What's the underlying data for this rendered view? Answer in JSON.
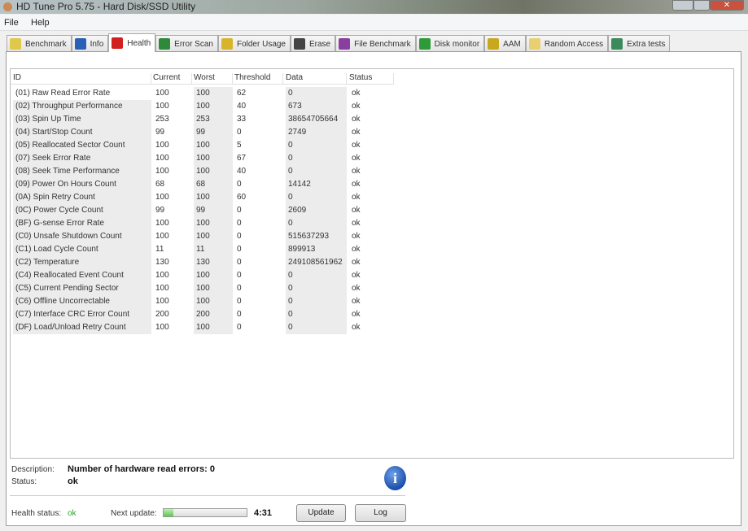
{
  "window": {
    "title": "HD Tune Pro 5.75 - Hard Disk/SSD Utility"
  },
  "menu": [
    "File",
    "Help"
  ],
  "tabs": [
    {
      "label": "Benchmark",
      "color": "#e0c84a"
    },
    {
      "label": "Info",
      "color": "#2a5fb8"
    },
    {
      "label": "Health",
      "color": "#d22020"
    },
    {
      "label": "Error Scan",
      "color": "#2e8a3a"
    },
    {
      "label": "Folder Usage",
      "color": "#d7b52a"
    },
    {
      "label": "Erase",
      "color": "#444444"
    },
    {
      "label": "File Benchmark",
      "color": "#8a3fa0"
    },
    {
      "label": "Disk monitor",
      "color": "#2f9a3a"
    },
    {
      "label": "AAM",
      "color": "#c9a820"
    },
    {
      "label": "Random Access",
      "color": "#e8d070"
    },
    {
      "label": "Extra tests",
      "color": "#3a8a5a"
    }
  ],
  "active_tab": "Health",
  "table": {
    "columns": [
      "ID",
      "Current",
      "Worst",
      "Threshold",
      "Data",
      "Status"
    ],
    "rows": [
      [
        "(01) Raw Read Error Rate",
        "100",
        "100",
        "62",
        "0",
        "ok"
      ],
      [
        "(02) Throughput Performance",
        "100",
        "100",
        "40",
        "673",
        "ok"
      ],
      [
        "(03) Spin Up Time",
        "253",
        "253",
        "33",
        "38654705664",
        "ok"
      ],
      [
        "(04) Start/Stop Count",
        "99",
        "99",
        "0",
        "2749",
        "ok"
      ],
      [
        "(05) Reallocated Sector Count",
        "100",
        "100",
        "5",
        "0",
        "ok"
      ],
      [
        "(07) Seek Error Rate",
        "100",
        "100",
        "67",
        "0",
        "ok"
      ],
      [
        "(08) Seek Time Performance",
        "100",
        "100",
        "40",
        "0",
        "ok"
      ],
      [
        "(09) Power On Hours Count",
        "68",
        "68",
        "0",
        "14142",
        "ok"
      ],
      [
        "(0A) Spin Retry Count",
        "100",
        "100",
        "60",
        "0",
        "ok"
      ],
      [
        "(0C) Power Cycle Count",
        "99",
        "99",
        "0",
        "2609",
        "ok"
      ],
      [
        "(BF) G-sense Error Rate",
        "100",
        "100",
        "0",
        "0",
        "ok"
      ],
      [
        "(C0) Unsafe Shutdown Count",
        "100",
        "100",
        "0",
        "515637293",
        "ok"
      ],
      [
        "(C1) Load Cycle Count",
        "11",
        "11",
        "0",
        "899913",
        "ok"
      ],
      [
        "(C2) Temperature",
        "130",
        "130",
        "0",
        "249108561962",
        "ok"
      ],
      [
        "(C4) Reallocated Event Count",
        "100",
        "100",
        "0",
        "0",
        "ok"
      ],
      [
        "(C5) Current Pending Sector",
        "100",
        "100",
        "0",
        "0",
        "ok"
      ],
      [
        "(C6) Offline Uncorrectable",
        "100",
        "100",
        "0",
        "0",
        "ok"
      ],
      [
        "(C7) Interface CRC Error Count",
        "200",
        "200",
        "0",
        "0",
        "ok"
      ],
      [
        "(DF) Load/Unload Retry Count",
        "100",
        "100",
        "0",
        "0",
        "ok"
      ]
    ]
  },
  "details": {
    "description_label": "Description:",
    "description": "Number of hardware read errors: 0",
    "status_label": "Status:",
    "status": "ok"
  },
  "footer": {
    "health_label": "Health status:",
    "health": "ok",
    "next_update_label": "Next update:",
    "progress_percent": 12,
    "countdown": "4:31",
    "update_button": "Update",
    "log_button": "Log"
  }
}
